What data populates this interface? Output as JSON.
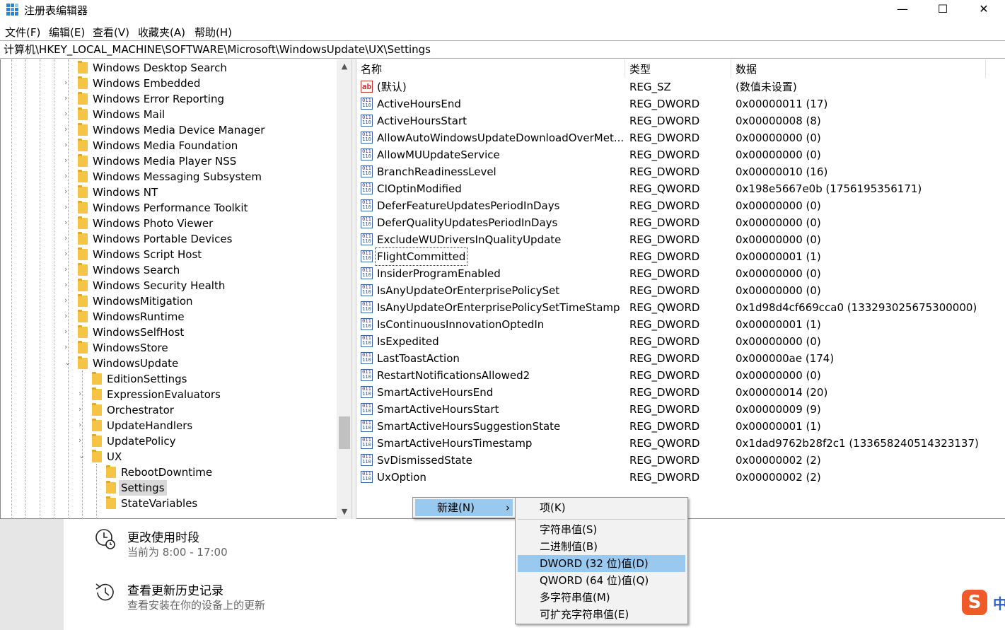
{
  "window": {
    "title": "注册表编辑器",
    "minimize_glyph": "—",
    "maximize_glyph": "☐",
    "close_glyph": "✕"
  },
  "menubar": [
    "文件(F)",
    "编辑(E)",
    "查看(V)",
    "收藏夹(A)",
    "帮助(H)"
  ],
  "address": "计算机\\HKEY_LOCAL_MACHINE\\SOFTWARE\\Microsoft\\WindowsUpdate\\UX\\Settings",
  "tree": [
    {
      "label": "Windows Desktop Search",
      "level": 0,
      "expander": ""
    },
    {
      "label": "Windows Embedded",
      "level": 0,
      "expander": "›"
    },
    {
      "label": "Windows Error Reporting",
      "level": 0,
      "expander": "›"
    },
    {
      "label": "Windows Mail",
      "level": 0,
      "expander": "›"
    },
    {
      "label": "Windows Media Device Manager",
      "level": 0,
      "expander": "›"
    },
    {
      "label": "Windows Media Foundation",
      "level": 0,
      "expander": "›"
    },
    {
      "label": "Windows Media Player NSS",
      "level": 0,
      "expander": "›"
    },
    {
      "label": "Windows Messaging Subsystem",
      "level": 0,
      "expander": "›"
    },
    {
      "label": "Windows NT",
      "level": 0,
      "expander": "›"
    },
    {
      "label": "Windows Performance Toolkit",
      "level": 0,
      "expander": "›"
    },
    {
      "label": "Windows Photo Viewer",
      "level": 0,
      "expander": "›"
    },
    {
      "label": "Windows Portable Devices",
      "level": 0,
      "expander": "›"
    },
    {
      "label": "Windows Script Host",
      "level": 0,
      "expander": "›"
    },
    {
      "label": "Windows Search",
      "level": 0,
      "expander": "›"
    },
    {
      "label": "Windows Security Health",
      "level": 0,
      "expander": "›"
    },
    {
      "label": "WindowsMitigation",
      "level": 0,
      "expander": "›"
    },
    {
      "label": "WindowsRuntime",
      "level": 0,
      "expander": "›"
    },
    {
      "label": "WindowsSelfHost",
      "level": 0,
      "expander": "›"
    },
    {
      "label": "WindowsStore",
      "level": 0,
      "expander": "›"
    },
    {
      "label": "WindowsUpdate",
      "level": 0,
      "expander": "⌄"
    },
    {
      "label": "EditionSettings",
      "level": 1,
      "expander": ""
    },
    {
      "label": "ExpressionEvaluators",
      "level": 1,
      "expander": "›"
    },
    {
      "label": "Orchestrator",
      "level": 1,
      "expander": "›"
    },
    {
      "label": "UpdateHandlers",
      "level": 1,
      "expander": "›"
    },
    {
      "label": "UpdatePolicy",
      "level": 1,
      "expander": "›"
    },
    {
      "label": "UX",
      "level": 1,
      "expander": "⌄"
    },
    {
      "label": "RebootDowntime",
      "level": 2,
      "expander": ""
    },
    {
      "label": "Settings",
      "level": 2,
      "expander": "",
      "selected": true
    },
    {
      "label": "StateVariables",
      "level": 2,
      "expander": ""
    }
  ],
  "list_columns": [
    "名称",
    "类型",
    "数据"
  ],
  "values": [
    {
      "name": "(默认)",
      "type": "REG_SZ",
      "data": "(数值未设置)",
      "icon": "string-value"
    },
    {
      "name": "ActiveHoursEnd",
      "type": "REG_DWORD",
      "data": "0x00000011 (17)",
      "icon": "binary-value"
    },
    {
      "name": "ActiveHoursStart",
      "type": "REG_DWORD",
      "data": "0x00000008 (8)",
      "icon": "binary-value"
    },
    {
      "name": "AllowAutoWindowsUpdateDownloadOverMet...",
      "type": "REG_DWORD",
      "data": "0x00000000 (0)",
      "icon": "binary-value"
    },
    {
      "name": "AllowMUUpdateService",
      "type": "REG_DWORD",
      "data": "0x00000000 (0)",
      "icon": "binary-value"
    },
    {
      "name": "BranchReadinessLevel",
      "type": "REG_DWORD",
      "data": "0x00000010 (16)",
      "icon": "binary-value"
    },
    {
      "name": "CIOptinModified",
      "type": "REG_QWORD",
      "data": "0x198e5667e0b (1756195356171)",
      "icon": "binary-value"
    },
    {
      "name": "DeferFeatureUpdatesPeriodInDays",
      "type": "REG_DWORD",
      "data": "0x00000000 (0)",
      "icon": "binary-value"
    },
    {
      "name": "DeferQualityUpdatesPeriodInDays",
      "type": "REG_DWORD",
      "data": "0x00000000 (0)",
      "icon": "binary-value"
    },
    {
      "name": "ExcludeWUDriversInQualityUpdate",
      "type": "REG_DWORD",
      "data": "0x00000000 (0)",
      "icon": "binary-value"
    },
    {
      "name": "FlightCommitted",
      "type": "REG_DWORD",
      "data": "0x00000001 (1)",
      "icon": "binary-value",
      "focused": true
    },
    {
      "name": "InsiderProgramEnabled",
      "type": "REG_DWORD",
      "data": "0x00000000 (0)",
      "icon": "binary-value"
    },
    {
      "name": "IsAnyUpdateOrEnterprisePolicySet",
      "type": "REG_DWORD",
      "data": "0x00000000 (0)",
      "icon": "binary-value"
    },
    {
      "name": "IsAnyUpdateOrEnterprisePolicySetTimeStamp",
      "type": "REG_QWORD",
      "data": "0x1d98d4cf669cca0 (133293025675300000)",
      "icon": "binary-value"
    },
    {
      "name": "IsContinuousInnovationOptedIn",
      "type": "REG_DWORD",
      "data": "0x00000001 (1)",
      "icon": "binary-value"
    },
    {
      "name": "IsExpedited",
      "type": "REG_DWORD",
      "data": "0x00000000 (0)",
      "icon": "binary-value"
    },
    {
      "name": "LastToastAction",
      "type": "REG_DWORD",
      "data": "0x000000ae (174)",
      "icon": "binary-value"
    },
    {
      "name": "RestartNotificationsAllowed2",
      "type": "REG_DWORD",
      "data": "0x00000000 (0)",
      "icon": "binary-value"
    },
    {
      "name": "SmartActiveHoursEnd",
      "type": "REG_DWORD",
      "data": "0x00000014 (20)",
      "icon": "binary-value"
    },
    {
      "name": "SmartActiveHoursStart",
      "type": "REG_DWORD",
      "data": "0x00000009 (9)",
      "icon": "binary-value"
    },
    {
      "name": "SmartActiveHoursSuggestionState",
      "type": "REG_DWORD",
      "data": "0x00000001 (1)",
      "icon": "binary-value"
    },
    {
      "name": "SmartActiveHoursTimestamp",
      "type": "REG_QWORD",
      "data": "0x1dad9762b28f2c1 (133658240514323137)",
      "icon": "binary-value"
    },
    {
      "name": "SvDismissedState",
      "type": "REG_DWORD",
      "data": "0x00000002 (2)",
      "icon": "binary-value"
    },
    {
      "name": "UxOption",
      "type": "REG_DWORD",
      "data": "0x00000002 (2)",
      "icon": "binary-value"
    }
  ],
  "context_menu": {
    "new_label": "新建(N)",
    "arrow": "›"
  },
  "submenu": {
    "item_key": "项(K)",
    "items": [
      "字符串值(S)",
      "二进制值(B)",
      "DWORD (32 位)值(D)",
      "QWORD (64 位)值(Q)",
      "多字符串值(M)",
      "可扩充字符串值(E)"
    ],
    "highlighted": "DWORD (32 位)值(D)"
  },
  "settings_page": {
    "active_hours_title": "更改使用时段",
    "active_hours_sub": "当前为 8:00 - 17:00",
    "history_title": "查看更新历史记录",
    "history_sub": "查看安装在你的设备上的更新"
  },
  "ime": {
    "logo": "S",
    "mode": "中"
  },
  "colors": {
    "folder": "#f5c444",
    "menu_highlight": "#99c9ef",
    "ime": "#ef5a28"
  }
}
